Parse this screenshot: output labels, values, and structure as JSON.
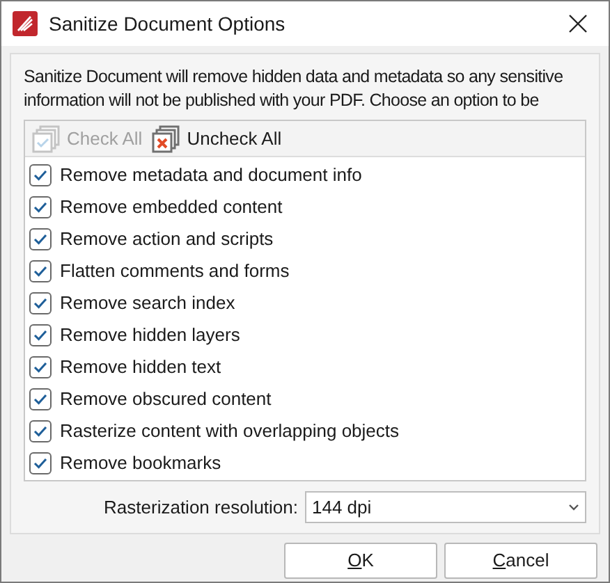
{
  "window": {
    "title": "Sanitize Document Options"
  },
  "description": "Sanitize Document will remove hidden data and metadata so any sensitive information will not be published with your PDF. Choose an option to be",
  "toolbar": [
    {
      "label": "Check All",
      "kind": "check",
      "disabled": true
    },
    {
      "label": "Uncheck All",
      "kind": "uncheck",
      "disabled": false
    }
  ],
  "options": [
    {
      "label": "Remove metadata and document info",
      "checked": true
    },
    {
      "label": "Remove embedded content",
      "checked": true
    },
    {
      "label": "Remove action and scripts",
      "checked": true
    },
    {
      "label": "Flatten comments and forms",
      "checked": true
    },
    {
      "label": "Remove search index",
      "checked": true
    },
    {
      "label": "Remove hidden layers",
      "checked": true
    },
    {
      "label": "Remove hidden text",
      "checked": true
    },
    {
      "label": "Remove obscured content",
      "checked": true
    },
    {
      "label": "Rasterize content with overlapping objects",
      "checked": true
    },
    {
      "label": "Remove bookmarks",
      "checked": true
    }
  ],
  "resolution": {
    "label": "Rasterization resolution:",
    "value": "144 dpi"
  },
  "buttons": [
    {
      "label": "OK"
    },
    {
      "label": "Cancel"
    }
  ]
}
